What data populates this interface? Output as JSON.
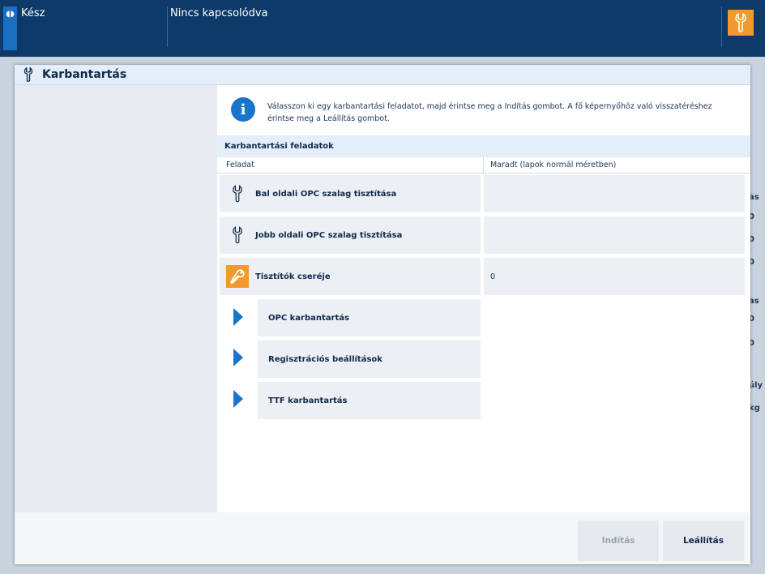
{
  "topbar": {
    "status_tab_glyph": "◖◗",
    "status": "Kész",
    "connection": "Nincs kapcsolódva"
  },
  "background": {
    "side_labels": [
      "as",
      "0",
      "0",
      "0",
      "as",
      "0",
      "0",
      "úly",
      "kg"
    ]
  },
  "dialog": {
    "title": "Karbantartás",
    "info_text": "Válasszon ki egy karbantartási feladatot, majd érintse meg a Indítás gombot. A fő képernyőhöz való visszatéréshez érintse meg a Leállítás gombot.",
    "section_title": "Karbantartási feladatok",
    "col_task": "Feladat",
    "col_remaining": "Maradt (lapok normál méretben)",
    "tasks": [
      {
        "label": "Bal oldali OPC szalag tisztítása",
        "remaining": "",
        "icon": "wrench-icon",
        "highlight": false
      },
      {
        "label": "Jobb oldali OPC szalag tisztítása",
        "remaining": "",
        "icon": "wrench-icon",
        "highlight": false
      },
      {
        "label": "Tisztítók cseréje",
        "remaining": "0",
        "icon": "wrench-icon",
        "highlight": true
      }
    ],
    "nav_items": [
      {
        "label": "OPC karbantartás"
      },
      {
        "label": "Regisztrációs beállítások"
      },
      {
        "label": "TTF karbantartás"
      }
    ],
    "buttons": {
      "start": "Indítás",
      "stop": "Leállítás"
    }
  },
  "colors": {
    "topbar": "#0d3a68",
    "accent_blue": "#1a74c9",
    "accent_orange": "#f29a2e"
  }
}
